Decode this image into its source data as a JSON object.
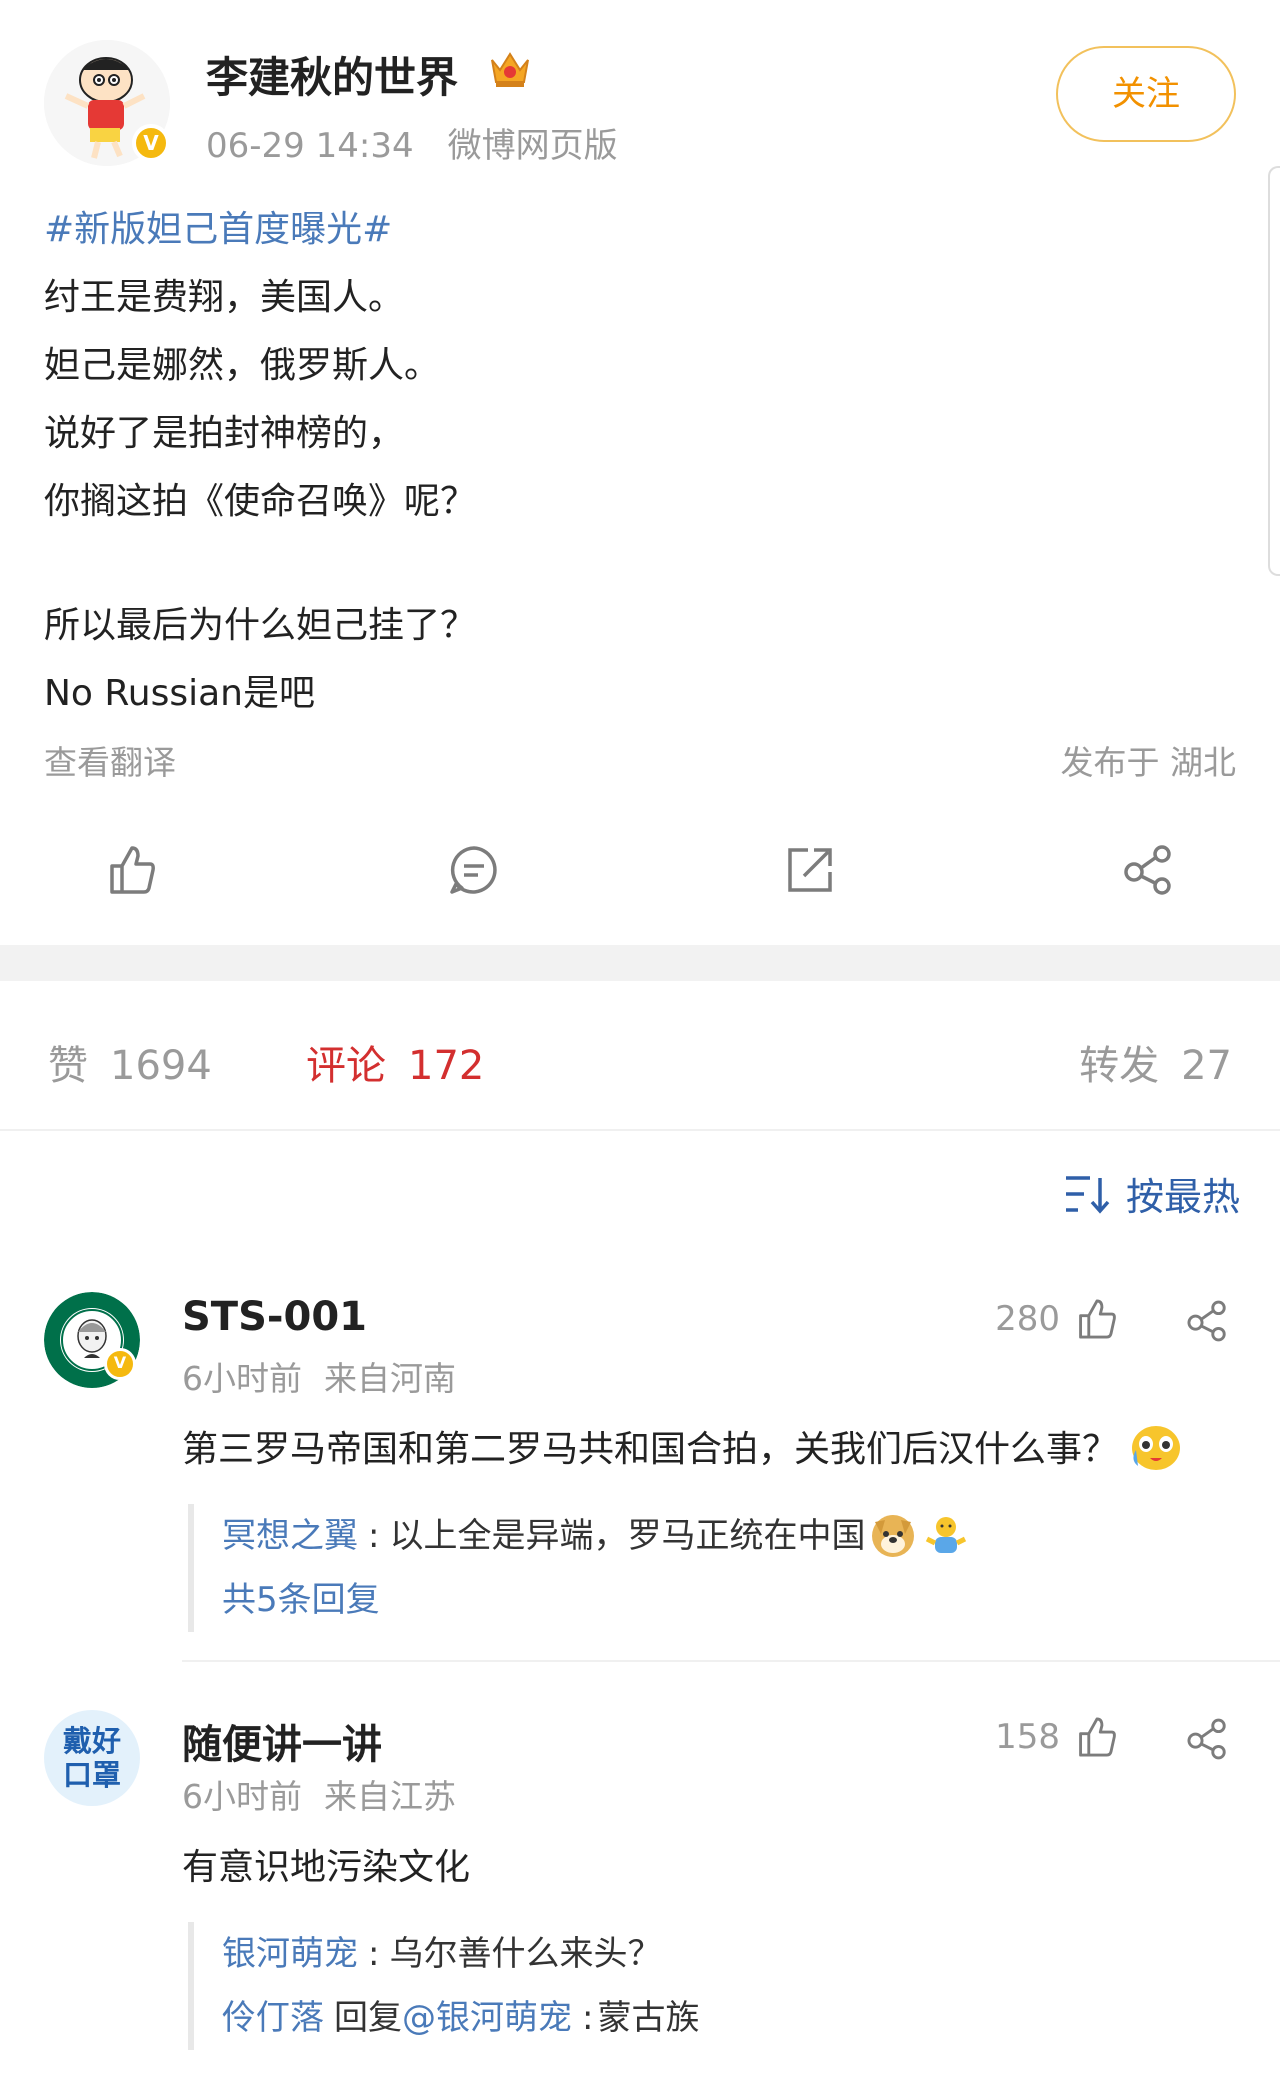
{
  "post": {
    "author": "李建秋的世界",
    "time": "06-29 14:34",
    "source": "微博网页版",
    "follow_label": "关注",
    "topic": "#新版妲己首度曝光#",
    "lines": [
      "纣王是费翔，美国人。",
      "妲己是娜然，俄罗斯人。",
      "说好了是拍封神榜的，",
      "你搁这拍《使命召唤》呢？"
    ],
    "lines2": [
      "所以最后为什么妲己挂了？",
      "No Russian是吧"
    ],
    "translate_label": "查看翻译",
    "location": "发布于 湖北",
    "action_icons": [
      "like-icon",
      "comment-icon",
      "repost-icon",
      "share-icon"
    ]
  },
  "stats": {
    "likes_label": "赞",
    "likes_count": "1694",
    "comments_label": "评论",
    "comments_count": "172",
    "reposts_label": "转发",
    "reposts_count": "27"
  },
  "sort": {
    "label": "按最热"
  },
  "comments": [
    {
      "user": "STS-001",
      "time": "6小时前",
      "from": "来自河南",
      "likes": "280",
      "text": "第三罗马帝国和第二罗马共和国合拍，关我们后汉什么事？",
      "replies": [
        {
          "user": "冥想之翼",
          "sep": ":",
          "text": "以上全是异端，罗马正统在中国"
        }
      ],
      "more": "共5条回复"
    },
    {
      "user": "随便讲一讲",
      "avatar_text_1": "戴好",
      "avatar_text_2": "口罩",
      "time": "6小时前",
      "from": "来自江苏",
      "likes": "158",
      "text": "有意识地污染文化",
      "replies": [
        {
          "user": "银河萌宠",
          "sep": ":",
          "text": "乌尔善什么来头？"
        },
        {
          "user": "伶仃落",
          "mid": "回复",
          "target": "@银河萌宠",
          "sep": ":",
          "text": "蒙古族"
        }
      ]
    }
  ],
  "colors": {
    "link": "#4a7ab9",
    "active": "#d32f2f",
    "follow": "#f29100",
    "muted": "#9a9a9a"
  }
}
